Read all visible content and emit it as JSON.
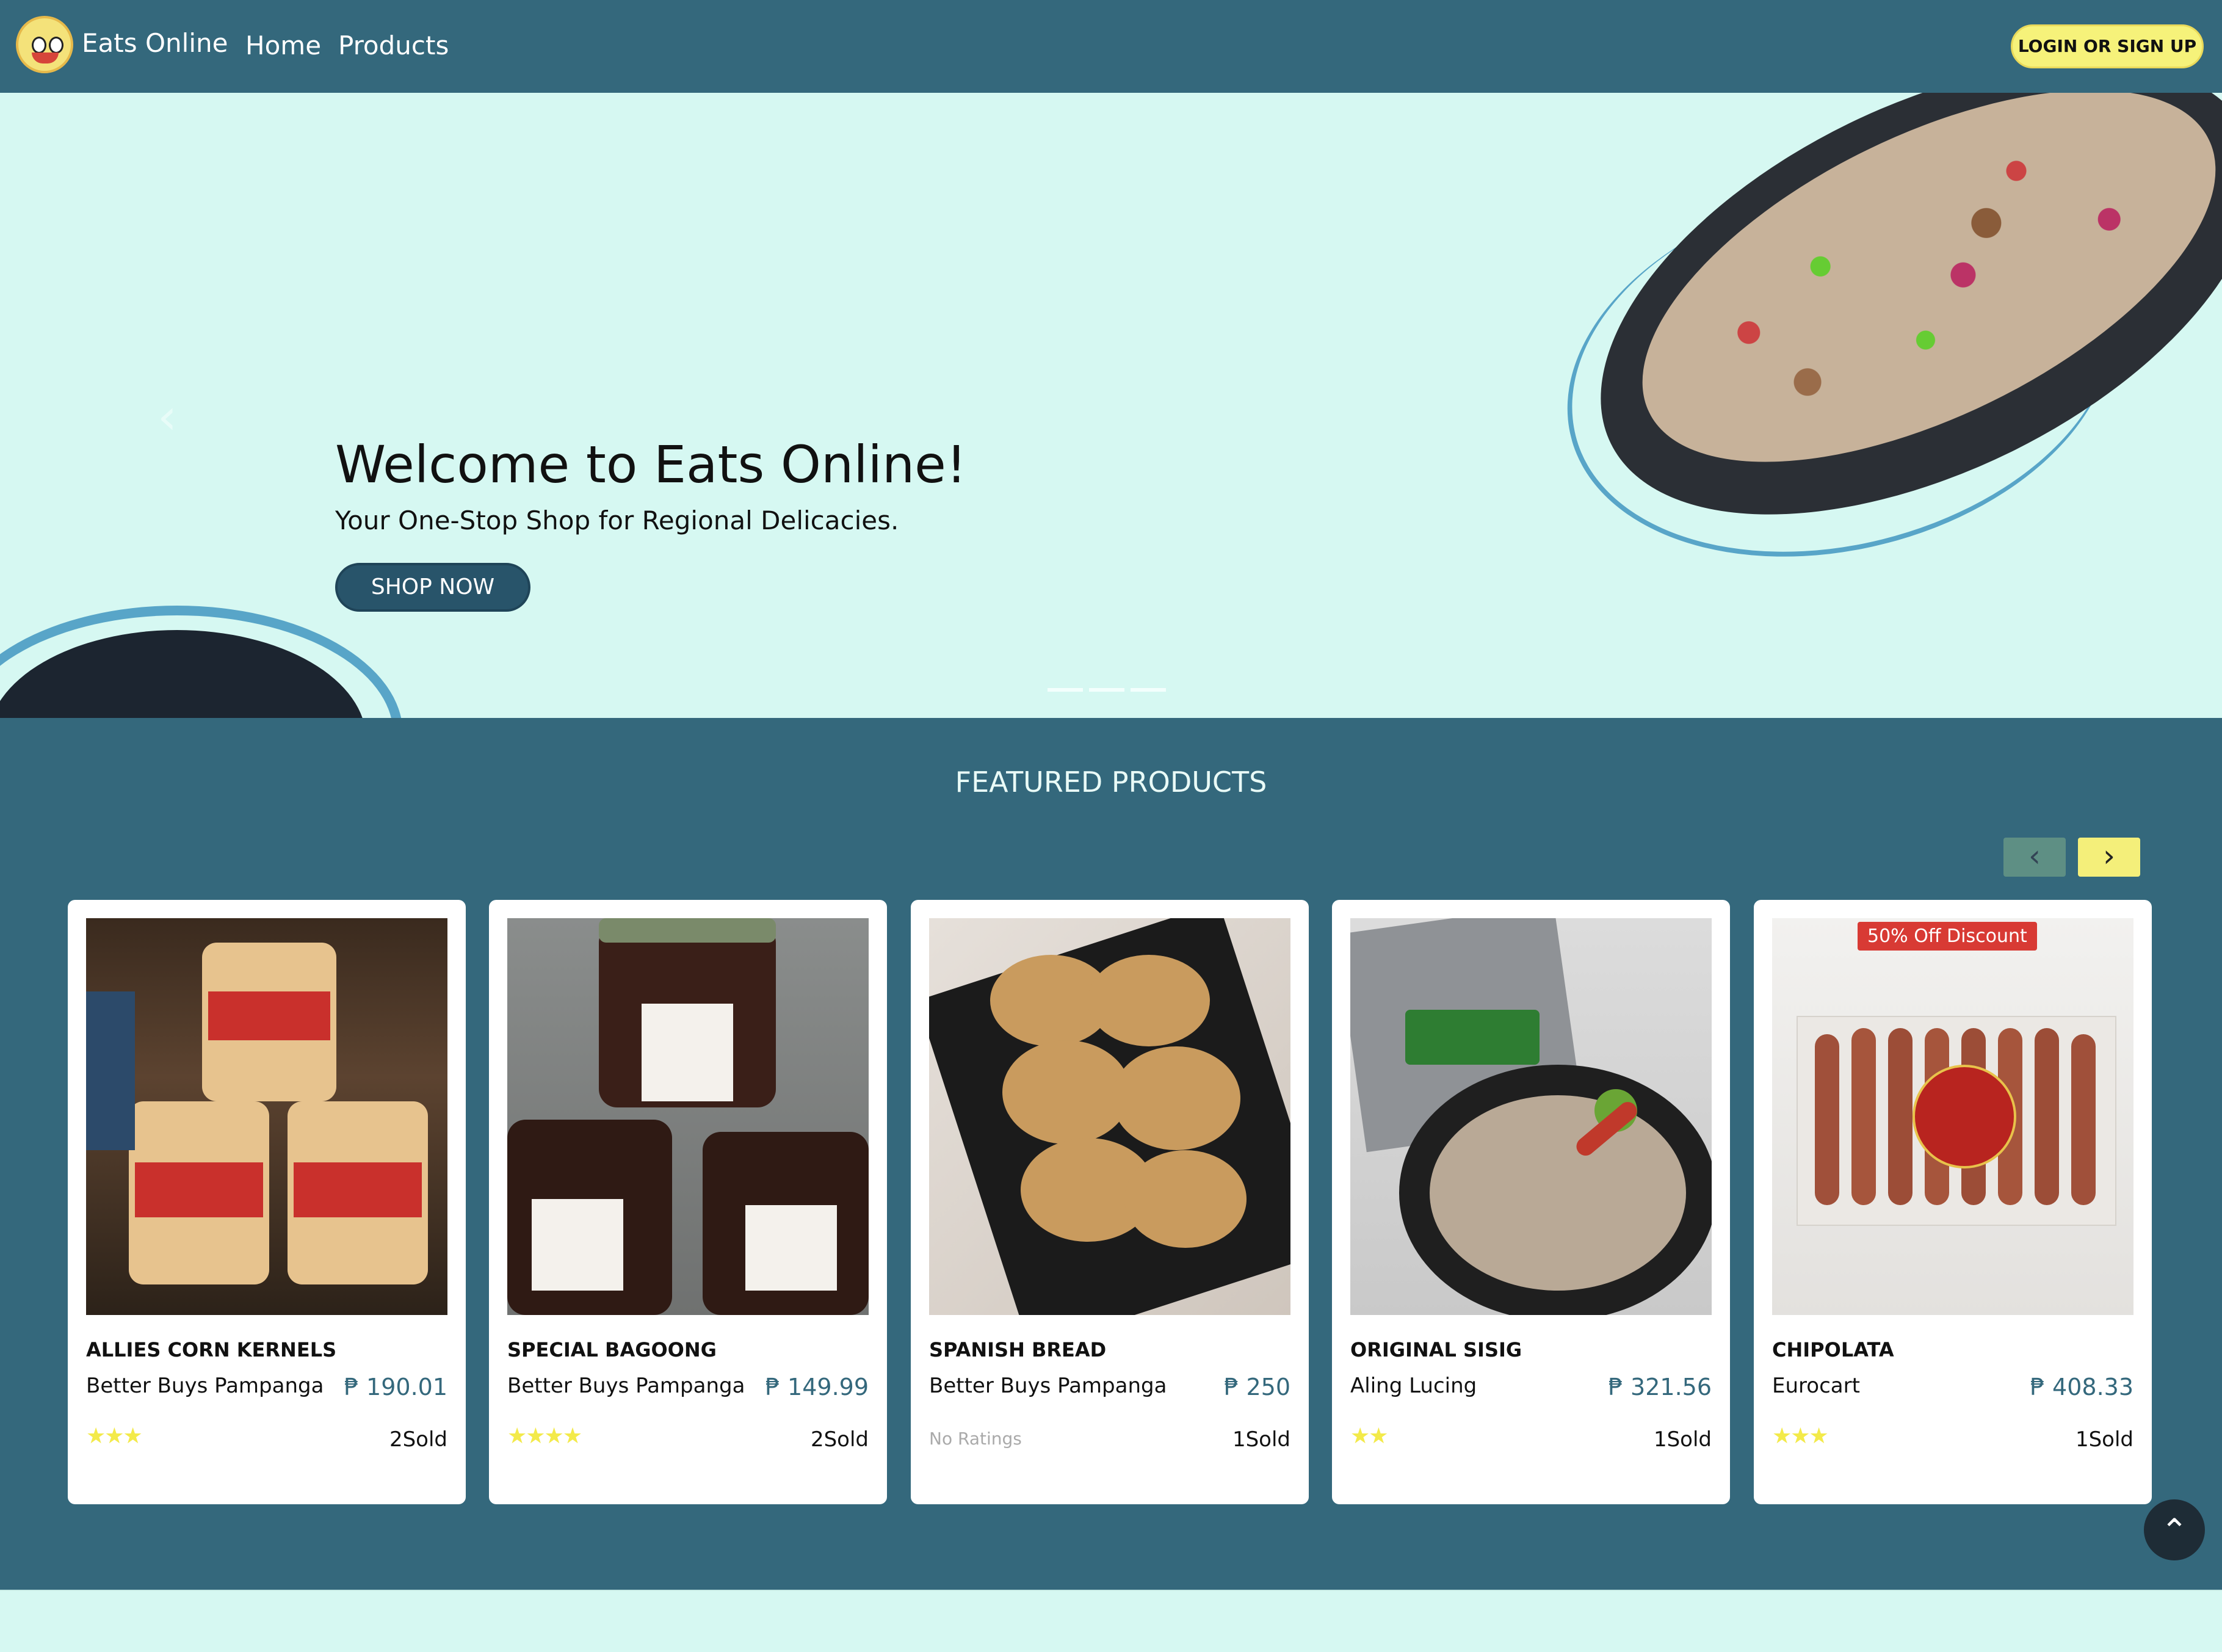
{
  "nav": {
    "brand": "Eats Online",
    "links": [
      "Home",
      "Products"
    ],
    "login_label": "LOGIN OR SIGN UP",
    "logo_text": "Eats Online"
  },
  "hero": {
    "title": "Welcome to Eats Online!",
    "subtitle": "Your One-Stop Shop for Regional Delicacies.",
    "cta": "SHOP NOW",
    "prev_arrow": "‹",
    "carousel_slide_count": 3,
    "carousel_active_index": 0
  },
  "featured": {
    "title": "FEATURED PRODUCTS",
    "prev_label": "‹",
    "next_label": "›",
    "products": [
      {
        "name": "ALLIES CORN KERNELS",
        "seller": "Better Buys Pampanga",
        "price": "₱ 190.01",
        "stars": "★★★",
        "rating": 3,
        "sold": "2Sold",
        "badge": ""
      },
      {
        "name": "SPECIAL BAGOONG",
        "seller": "Better Buys Pampanga",
        "price": "₱ 149.99",
        "stars": "★★★★",
        "rating": 4,
        "sold": "2Sold",
        "badge": ""
      },
      {
        "name": "SPANISH BREAD",
        "seller": "Better Buys Pampanga",
        "price": "₱ 250",
        "stars": "",
        "rating_text": "No Ratings",
        "sold": "1Sold",
        "badge": ""
      },
      {
        "name": "ORIGINAL SISIG",
        "seller": "Aling Lucing",
        "price": "₱ 321.56",
        "stars": "★★",
        "rating": 2,
        "sold": "1Sold",
        "badge": ""
      },
      {
        "name": "CHIPOLATA",
        "seller": "Eurocart",
        "price": "₱ 408.33",
        "stars": "★★★",
        "rating": 3,
        "sold": "1Sold",
        "badge": "50% Off Discount"
      }
    ]
  },
  "scroll_top": "⌃",
  "colors": {
    "nav_bg": "#34687c",
    "hero_bg": "#d6f8f2",
    "accent_yellow": "#f6f27a",
    "cta_bg": "#28546a",
    "star": "#f3ea4a",
    "badge": "#d83a34"
  }
}
